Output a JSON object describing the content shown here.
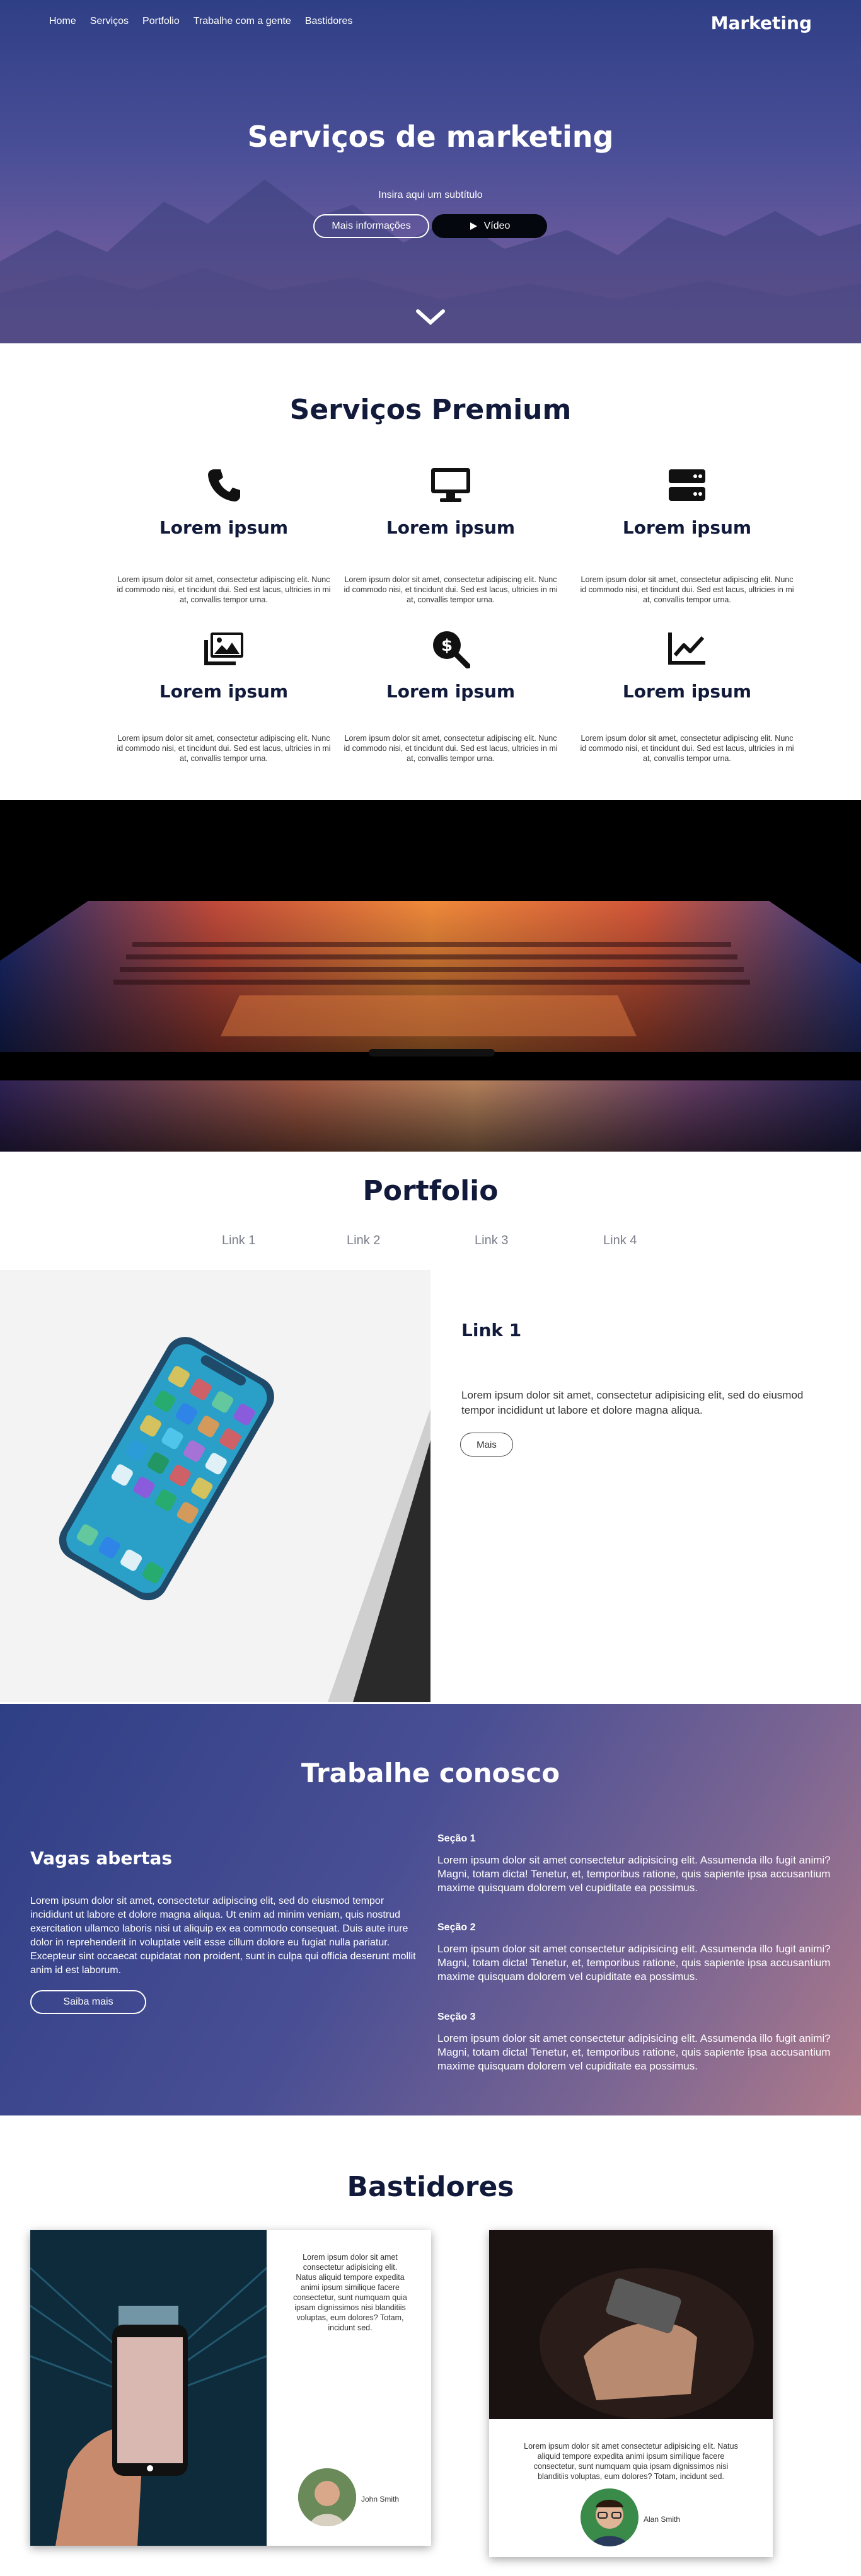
{
  "header": {
    "nav": [
      "Home",
      "Serviços",
      "Portfolio",
      "Trabalhe com a gente",
      "Bastidores"
    ],
    "brand": "Marketing"
  },
  "hero": {
    "title": "Serviços de marketing",
    "subtitle": "Insira aqui um subtítulo",
    "more_button": "Mais informações",
    "video_button": "Vídeo"
  },
  "services": {
    "title": "Serviços Premium",
    "items": [
      {
        "icon": "phone-icon",
        "title": "Lorem ipsum",
        "text": "Lorem ipsum dolor sit amet, consectetur adipiscing elit. Nunc id commodo nisi, et tincidunt dui. Sed est lacus, ultricies in mi at, convallis tempor urna."
      },
      {
        "icon": "desktop-icon",
        "title": "Lorem ipsum",
        "text": "Lorem ipsum dolor sit amet, consectetur adipiscing elit. Nunc id commodo nisi, et tincidunt dui. Sed est lacus, ultricies in mi at, convallis tempor urna."
      },
      {
        "icon": "server-icon",
        "title": "Lorem ipsum",
        "text": "Lorem ipsum dolor sit amet, consectetur adipiscing elit. Nunc id commodo nisi, et tincidunt dui. Sed est lacus, ultricies in mi at, convallis tempor urna."
      },
      {
        "icon": "images-icon",
        "title": "Lorem ipsum",
        "text": "Lorem ipsum dolor sit amet, consectetur adipiscing elit. Nunc id commodo nisi, et tincidunt dui. Sed est lacus, ultricies in mi at, convallis tempor urna."
      },
      {
        "icon": "search-dollar-icon",
        "title": "Lorem ipsum",
        "text": "Lorem ipsum dolor sit amet, consectetur adipiscing elit. Nunc id commodo nisi, et tincidunt dui. Sed est lacus, ultricies in mi at, convallis tempor urna."
      },
      {
        "icon": "chart-line-icon",
        "title": "Lorem ipsum",
        "text": "Lorem ipsum dolor sit amet, consectetur adipiscing elit. Nunc id commodo nisi, et tincidunt dui. Sed est lacus, ultricies in mi at, convallis tempor urna."
      }
    ]
  },
  "portfolio": {
    "title": "Portfolio",
    "links": [
      "Link 1",
      "Link 2",
      "Link 3",
      "Link 4"
    ],
    "active": {
      "title": "Link 1",
      "text": "Lorem ipsum dolor sit amet, consectetur adipisicing elit, sed do eiusmod tempor incididunt ut labore et dolore magna aliqua.",
      "button": "Mais"
    }
  },
  "work": {
    "title": "Trabalhe conosco",
    "vagas_title": "Vagas abertas",
    "vagas_text": "Lorem ipsum dolor sit amet, consectetur adipiscing elit, sed do eiusmod tempor incididunt ut labore et dolore magna aliqua. Ut enim ad minim veniam, quis nostrud exercitation ullamco laboris nisi ut aliquip ex ea commodo consequat. Duis aute irure dolor in reprehenderit in voluptate velit esse cillum dolore eu fugiat nulla pariatur. Excepteur sint occaecat cupidatat non proident, sunt in culpa qui officia deserunt mollit anim id est laborum.",
    "button": "Saiba mais",
    "sections": [
      {
        "title": "Seção 1",
        "text": "Lorem ipsum dolor sit amet consectetur adipisicing elit. Assumenda illo fugit animi? Magni, totam dicta! Tenetur, et, temporibus ratione, quis sapiente ipsa accusantium maxime quisquam dolorem vel cupiditate ea possimus."
      },
      {
        "title": "Seção 2",
        "text": "Lorem ipsum dolor sit amet consectetur adipisicing elit. Assumenda illo fugit animi? Magni, totam dicta! Tenetur, et, temporibus ratione, quis sapiente ipsa accusantium maxime quisquam dolorem vel cupiditate ea possimus."
      },
      {
        "title": "Seção 3",
        "text": "Lorem ipsum dolor sit amet consectetur adipisicing elit. Assumenda illo fugit animi? Magni, totam dicta! Tenetur, et, temporibus ratione, quis sapiente ipsa accusantium maxime quisquam dolorem vel cupiditate ea possimus."
      }
    ]
  },
  "bastidores": {
    "title": "Bastidores",
    "cards": [
      {
        "text": "Lorem ipsum dolor sit amet consectetur adipisicing elit. Natus aliquid tempore expedita animi ipsum similique facere consectetur, sunt numquam quia ipsam dignissimos nisi blanditiis voluptas, eum dolores? Totam, incidunt sed.",
        "name": "John Smith"
      },
      {
        "text": "Lorem ipsum dolor sit amet consectetur adipisicing elit. Natus aliquid tempore expedita animi ipsum similique facere consectetur, sunt numquam quia ipsam dignissimos nisi blanditiis voluptas, eum dolores? Totam, incidunt sed.",
        "name": "Alan Smith"
      }
    ]
  },
  "colors": {
    "navy": "#111a3a",
    "hero_top": "#2f3f86",
    "hero_bottom": "#8d6490",
    "button_dark": "#05070e"
  }
}
